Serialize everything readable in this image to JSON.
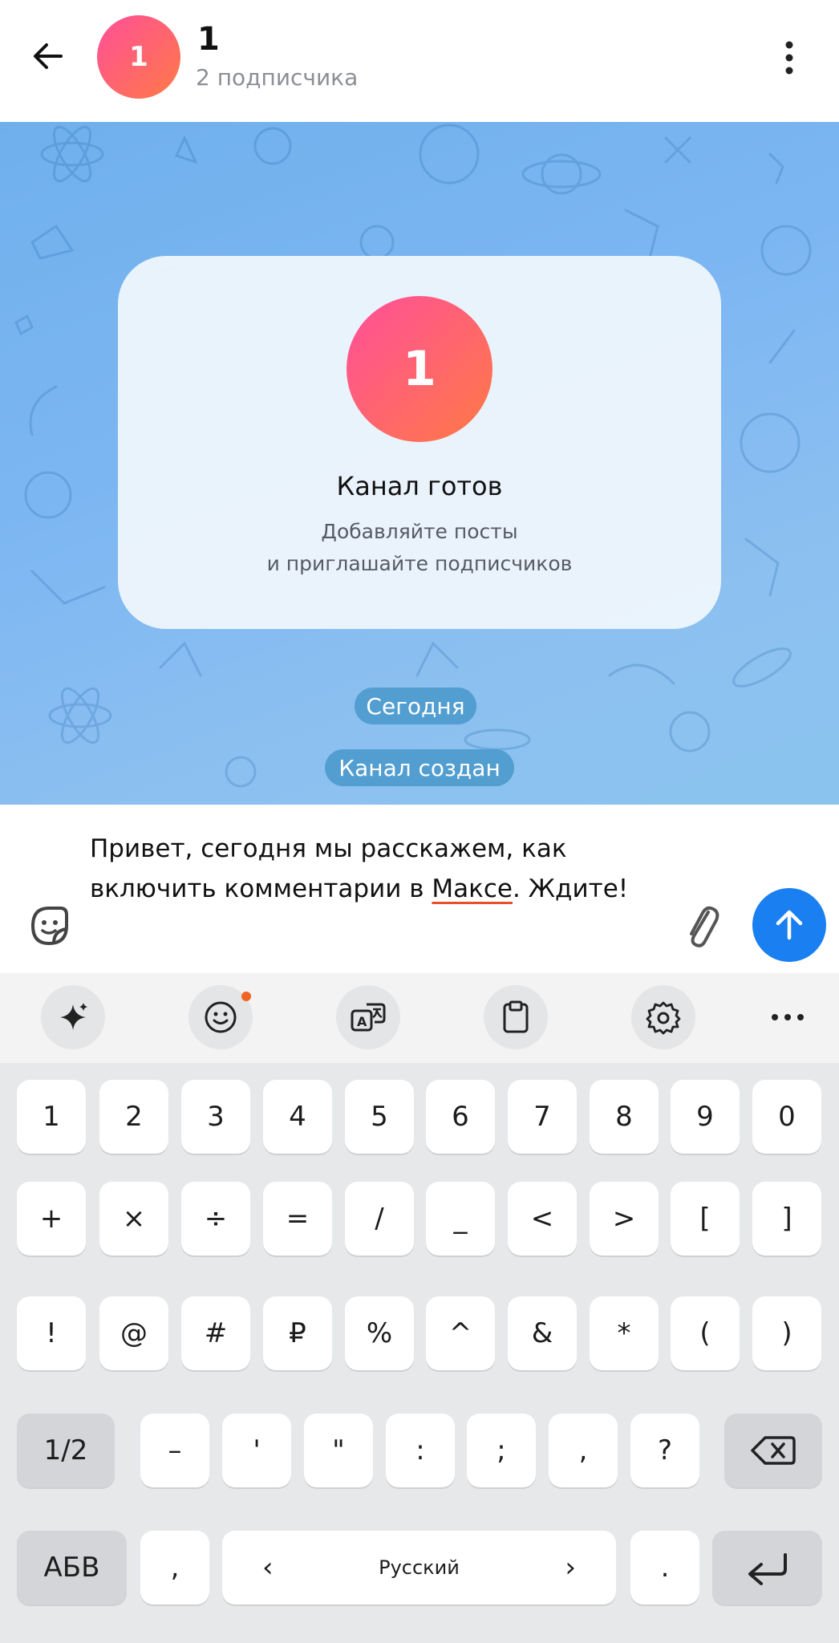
{
  "header": {
    "channel_name": "1",
    "avatar_letter": "1",
    "subscribers": "2 подписчика"
  },
  "card": {
    "avatar_letter": "1",
    "title": "Канал готов",
    "line1": "Добавляйте посты",
    "line2": "и приглашайте подписчиков"
  },
  "chat": {
    "date_pill": "Сегодня",
    "service_message": "Канал создан"
  },
  "composer": {
    "text_before": "Привет, сегодня мы расскажем, как включить комментарии в ",
    "text_underlined": "Максе",
    "text_after": ". Ждите!"
  },
  "keyboard": {
    "row1": [
      "1",
      "2",
      "3",
      "4",
      "5",
      "6",
      "7",
      "8",
      "9",
      "0"
    ],
    "row2": [
      "+",
      "×",
      "÷",
      "=",
      "/",
      "_",
      "<",
      ">",
      "[",
      "]"
    ],
    "row3": [
      "!",
      "@",
      "#",
      "₽",
      "%",
      "^",
      "&",
      "*",
      "(",
      ")"
    ],
    "row4_shift": "1/2",
    "row4": [
      "–",
      "'",
      "\"",
      ":",
      ";",
      ",",
      "?"
    ],
    "abc": "АБВ",
    "comma": ",",
    "language": "Русский",
    "period": ".",
    "notification_color": "#f06424"
  },
  "colors": {
    "accent": "#1a7ff0",
    "avatar_gradient_start": "#ff4f9a",
    "avatar_gradient_end": "#ff7a45",
    "underline": "#e8502a"
  }
}
